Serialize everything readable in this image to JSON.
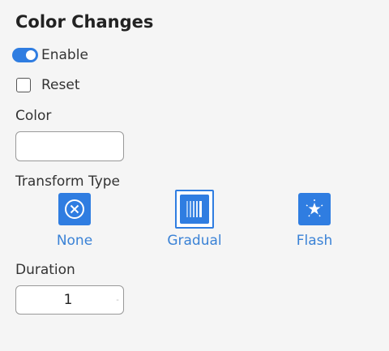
{
  "panel": {
    "title": "Color Changes"
  },
  "enable": {
    "label": "Enable",
    "on": true
  },
  "reset": {
    "label": "Reset",
    "checked": false
  },
  "color": {
    "label": "Color",
    "value": ""
  },
  "transform": {
    "label": "Transform Type",
    "options": [
      {
        "label": "None",
        "icon": "circle-x-icon",
        "selected": false
      },
      {
        "label": "Gradual",
        "icon": "gradient-bars-icon",
        "selected": true
      },
      {
        "label": "Flash",
        "icon": "sparkle-star-icon",
        "selected": false
      }
    ]
  },
  "duration": {
    "label": "Duration",
    "value": "1",
    "arrow": "-"
  },
  "colors": {
    "accent": "#2f7de1",
    "option_text": "#3a82d6"
  }
}
